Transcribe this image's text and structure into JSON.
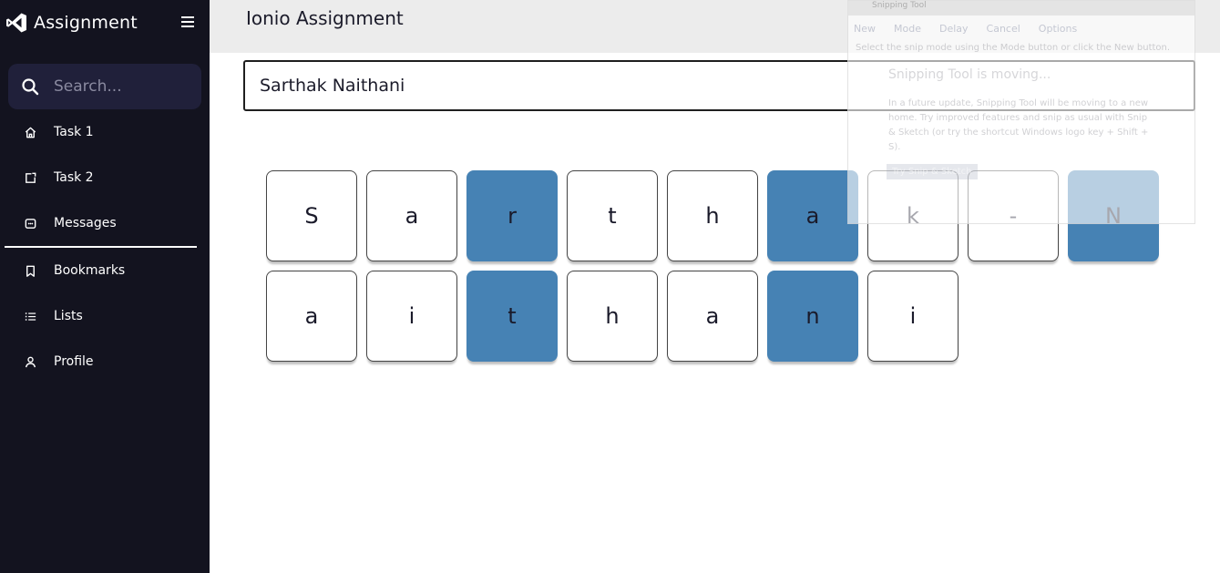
{
  "sidebar": {
    "brand": "Assignment",
    "search_placeholder": "Search...",
    "items": [
      {
        "label": "Task 1",
        "icon": "home-icon"
      },
      {
        "label": "Task 2",
        "icon": "external-link-icon"
      },
      {
        "label": "Messages",
        "icon": "message-icon"
      },
      {
        "label": "Bookmarks",
        "icon": "bookmark-icon"
      },
      {
        "label": "Lists",
        "icon": "list-icon"
      },
      {
        "label": "Profile",
        "icon": "user-icon"
      }
    ]
  },
  "header": {
    "title": "Ionio Assignment"
  },
  "main": {
    "name_value": "Sarthak Naithani",
    "tiles": [
      "S",
      "a",
      "r",
      "t",
      "h",
      "a",
      "k",
      "-",
      "N",
      "a",
      "i",
      "t",
      "h",
      "a",
      "n",
      "i"
    ],
    "highlighted": [
      2,
      5,
      8,
      11,
      14
    ],
    "highlight_color": "#4682b4"
  },
  "snipping_tool": {
    "title": "Snipping Tool",
    "toolbar": [
      "New",
      "Mode",
      "Delay",
      "Cancel",
      "Options"
    ],
    "hint": "Select the snip mode using the Mode button or click the New button.",
    "notice_title": "Snipping Tool is moving...",
    "notice_body": "In a future update, Snipping Tool will be moving to a new home. Try improved features and snip as usual with Snip & Sketch (or try the shortcut Windows logo key + Shift + S).",
    "notice_button": "Try Snip & Sketch"
  },
  "colors": {
    "sidebar_bg": "#13131f",
    "search_bg": "#20203a",
    "header_bg": "#ececec",
    "accent": "#4682b4"
  }
}
